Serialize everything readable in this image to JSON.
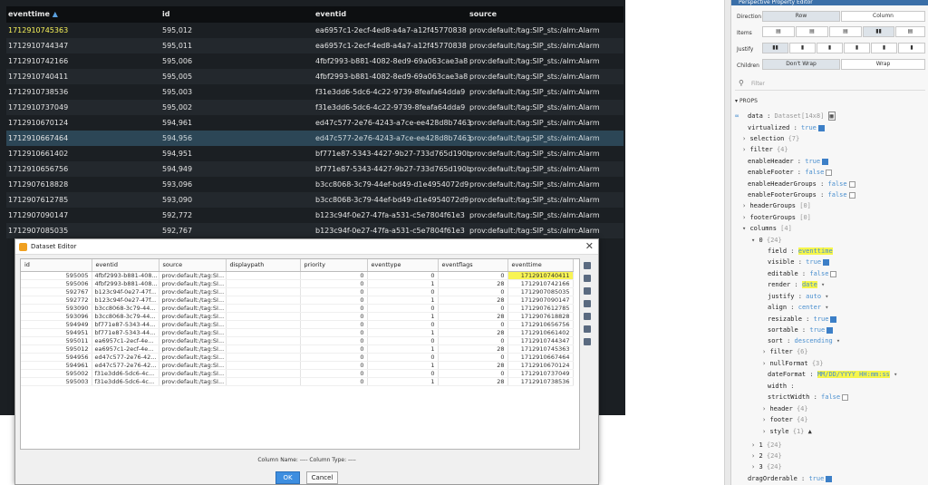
{
  "table": {
    "columns": [
      "eventtime",
      "id",
      "eventid",
      "source"
    ],
    "sort_icon": "sort-arrows-icon",
    "rows": [
      [
        "1712910745363",
        "595,012",
        "ea6957c1-2ecf-4ed8-a4a7-a12f45770838",
        "prov:default:/tag:SIP_sts:/alm:Alarm"
      ],
      [
        "1712910744347",
        "595,011",
        "ea6957c1-2ecf-4ed8-a4a7-a12f45770838",
        "prov:default:/tag:SIP_sts:/alm:Alarm"
      ],
      [
        "1712910742166",
        "595,006",
        "4fbf2993-b881-4082-8ed9-69a063cae3a8",
        "prov:default:/tag:SIP_sts:/alm:Alarm"
      ],
      [
        "1712910740411",
        "595,005",
        "4fbf2993-b881-4082-8ed9-69a063cae3a8",
        "prov:default:/tag:SIP_sts:/alm:Alarm"
      ],
      [
        "1712910738536",
        "595,003",
        "f31e3dd6-5dc6-4c22-9739-8feafa64dda9",
        "prov:default:/tag:SIP_sts:/alm:Alarm"
      ],
      [
        "1712910737049",
        "595,002",
        "f31e3dd6-5dc6-4c22-9739-8feafa64dda9",
        "prov:default:/tag:SIP_sts:/alm:Alarm"
      ],
      [
        "1712910670124",
        "594,961",
        "ed47c577-2e76-4243-a7ce-ee428d8b7463",
        "prov:default:/tag:SIP_sts:/alm:Alarm"
      ],
      [
        "1712910667464",
        "594,956",
        "ed47c577-2e76-4243-a7ce-ee428d8b7463",
        "prov:default:/tag:SIP_sts:/alm:Alarm"
      ],
      [
        "1712910661402",
        "594,951",
        "bf771e87-5343-4427-9b27-733d765d190b",
        "prov:default:/tag:SIP_sts:/alm:Alarm"
      ],
      [
        "1712910656756",
        "594,949",
        "bf771e87-5343-4427-9b27-733d765d190b",
        "prov:default:/tag:SIP_sts:/alm:Alarm"
      ],
      [
        "1712907618828",
        "593,096",
        "b3cc8068-3c79-44ef-bd49-d1e4954072d9",
        "prov:default:/tag:SIP_sts:/alm:Alarm"
      ],
      [
        "1712907612785",
        "593,090",
        "b3cc8068-3c79-44ef-bd49-d1e4954072d9",
        "prov:default:/tag:SIP_sts:/alm:Alarm"
      ],
      [
        "1712907090147",
        "592,772",
        "b123c94f-0e27-47fa-a531-c5e7804f61e3",
        "prov:default:/tag:SIP_sts:/alm:Alarm"
      ],
      [
        "1712907085035",
        "592,767",
        "b123c94f-0e27-47fa-a531-c5e7804f61e3",
        "prov:default:/tag:SIP_sts:/alm:Alarm"
      ]
    ]
  },
  "dataset_editor": {
    "title": "Dataset Editor",
    "columns": [
      "id",
      "eventid",
      "source",
      "displaypath",
      "priority",
      "eventtype",
      "eventflags",
      "eventtime"
    ],
    "rows": [
      [
        "595005",
        "4fbf2993-b881-408...",
        "prov:default:/tag:SI...",
        "",
        "0",
        "0",
        "0",
        "1712910740411"
      ],
      [
        "595006",
        "4fbf2993-b881-408...",
        "prov:default:/tag:SI...",
        "",
        "0",
        "1",
        "28",
        "1712910742166"
      ],
      [
        "592767",
        "b123c94f-0e27-47f...",
        "prov:default:/tag:SI...",
        "",
        "0",
        "0",
        "0",
        "1712907085035"
      ],
      [
        "592772",
        "b123c94f-0e27-47f...",
        "prov:default:/tag:SI...",
        "",
        "0",
        "1",
        "28",
        "1712907090147"
      ],
      [
        "593090",
        "b3cc8068-3c79-44...",
        "prov:default:/tag:SI...",
        "",
        "0",
        "0",
        "0",
        "1712907612785"
      ],
      [
        "593096",
        "b3cc8068-3c79-44...",
        "prov:default:/tag:SI...",
        "",
        "0",
        "1",
        "28",
        "1712907618828"
      ],
      [
        "594949",
        "bf771e87-5343-44...",
        "prov:default:/tag:SI...",
        "",
        "0",
        "0",
        "0",
        "1712910656756"
      ],
      [
        "594951",
        "bf771e87-5343-44...",
        "prov:default:/tag:SI...",
        "",
        "0",
        "1",
        "28",
        "1712910661402"
      ],
      [
        "595011",
        "ea6957c1-2ecf-4e...",
        "prov:default:/tag:SI...",
        "",
        "0",
        "0",
        "0",
        "1712910744347"
      ],
      [
        "595012",
        "ea6957c1-2ecf-4e...",
        "prov:default:/tag:SI...",
        "",
        "0",
        "1",
        "28",
        "1712910745363"
      ],
      [
        "594956",
        "ed47c577-2e76-42...",
        "prov:default:/tag:SI...",
        "",
        "0",
        "0",
        "0",
        "1712910667464"
      ],
      [
        "594961",
        "ed47c577-2e76-42...",
        "prov:default:/tag:SI...",
        "",
        "0",
        "1",
        "28",
        "1712910670124"
      ],
      [
        "595002",
        "f31e3dd6-5dc6-4c...",
        "prov:default:/tag:SI...",
        "",
        "0",
        "0",
        "0",
        "1712910737049"
      ],
      [
        "595003",
        "f31e3dd6-5dc6-4c...",
        "prov:default:/tag:SI...",
        "",
        "0",
        "1",
        "28",
        "1712910738536"
      ]
    ],
    "column_info": "Column Name: ----   Column Type: ----",
    "ok_label": "OK",
    "cancel_label": "Cancel"
  },
  "property_editor": {
    "title": "Perspective Property Editor",
    "direction_label": "Direction",
    "direction_options": [
      "Row",
      "Column"
    ],
    "items_label": "Items",
    "justify_label": "Justify",
    "children_label": "Children",
    "children_options": [
      "Don't Wrap",
      "Wrap"
    ],
    "filter_placeholder": "Filter",
    "props_label": "PROPS",
    "data_key": "data",
    "data_value": "Dataset[14x8]",
    "virtualized_key": "virtualized",
    "virtualized_value": "true",
    "selection_key": "selection",
    "selection_count": "{7}",
    "filter_key": "filter",
    "filter_count": "{4}",
    "enableHeader_key": "enableHeader",
    "enableHeader_value": "true",
    "enableFooter_key": "enableFooter",
    "enableFooter_value": "false",
    "enableHeaderGroups_key": "enableHeaderGroups",
    "enableHeaderGroups_value": "false",
    "enableFooterGroups_key": "enableFooterGroups",
    "enableFooterGroups_value": "false",
    "headerGroups_key": "headerGroups",
    "headerGroups_count": "[0]",
    "footerGroups_key": "footerGroups",
    "footerGroups_count": "[0]",
    "columns_key": "columns",
    "columns_count": "[4]",
    "col0_key": "0",
    "col0_count": "{24}",
    "field_key": "field",
    "field_value": "eventtime",
    "visible_key": "visible",
    "visible_value": "true",
    "editable_key": "editable",
    "editable_value": "false",
    "render_key": "render",
    "render_value": "date",
    "justify_key": "justify",
    "justify_value": "auto",
    "align_key": "align",
    "align_value": "center",
    "resizable_key": "resizable",
    "resizable_value": "true",
    "sortable_key": "sortable",
    "sortable_value": "true",
    "sort_key": "sort",
    "sort_value": "descending",
    "colfilter_key": "filter",
    "colfilter_count": "{6}",
    "nullFormat_key": "nullFormat",
    "nullFormat_count": "{3}",
    "dateFormat_key": "dateFormat",
    "dateFormat_value": "MM/DD/YYYY HH:mm:ss",
    "width_key": "width",
    "strictWidth_key": "strictWidth",
    "strictWidth_value": "false",
    "header_key": "header",
    "header_count": "{4}",
    "footer_key": "footer",
    "footer_count": "{4}",
    "style_key": "style",
    "style_count": "{1}",
    "col1_key": "1",
    "col1_count": "{24}",
    "col2_key": "2",
    "col2_count": "{24}",
    "col3_key": "3",
    "col3_count": "{24}",
    "dragOrderable_key": "dragOrderable",
    "dragOrderable_value": "true"
  }
}
